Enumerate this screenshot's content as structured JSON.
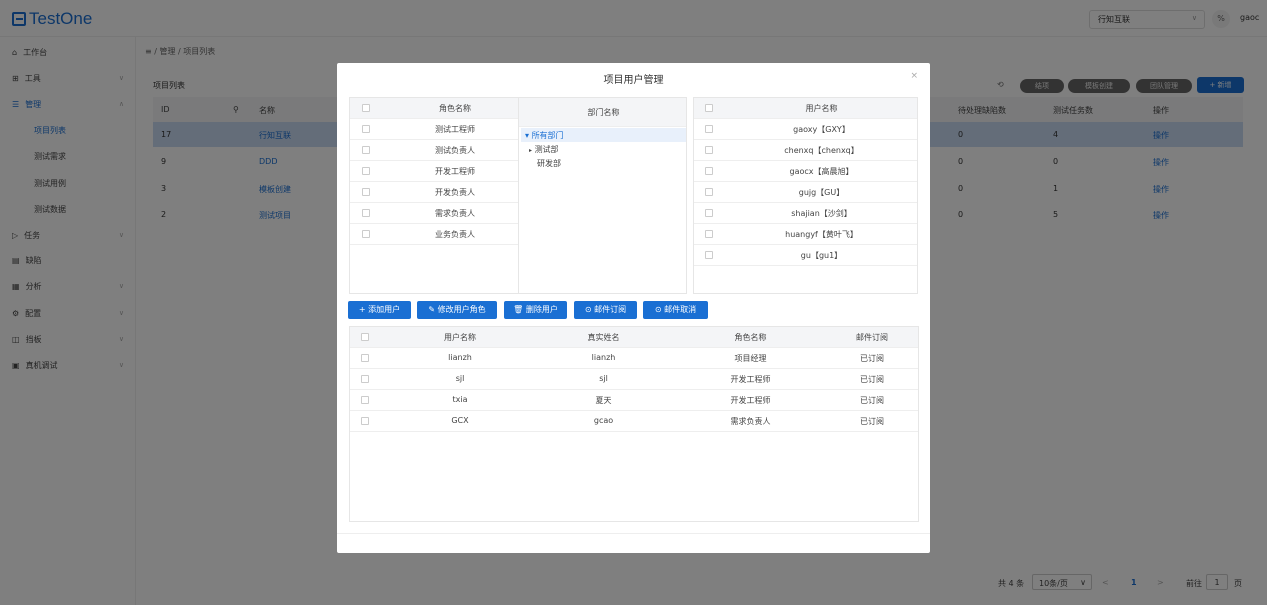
{
  "app": {
    "logo_text": "TestOne",
    "project_selected": "行知互联",
    "user_name": "gaoc",
    "user_icon": "%"
  },
  "sidebar": {
    "items": [
      {
        "label": "工作台"
      },
      {
        "label": "工具"
      },
      {
        "label": "管理"
      },
      {
        "label": "任务"
      },
      {
        "label": "缺陷"
      },
      {
        "label": "分析"
      },
      {
        "label": "配置"
      },
      {
        "label": "挡板"
      },
      {
        "label": "真机调试"
      }
    ],
    "subitems": [
      {
        "label": "项目列表"
      },
      {
        "label": "测试需求"
      },
      {
        "label": "测试用例"
      },
      {
        "label": "测试数据"
      }
    ]
  },
  "breadcrumb": {
    "home": "≡",
    "sep": "/",
    "parent": "管理",
    "current": "项目列表"
  },
  "page": {
    "section_title": "项目列表",
    "buttons": {
      "refresh": "⟲",
      "finish": "结项",
      "template": "模板创建",
      "team": "团队管理",
      "new": "+ 新增"
    },
    "columns": [
      "ID",
      "名称",
      "待处理缺陷数",
      "测试任务数",
      "操作"
    ],
    "rows": [
      {
        "id": "17",
        "name": "行知互联",
        "defects": "0",
        "tasks": "4",
        "action": "操作"
      },
      {
        "id": "9",
        "name": "DDD",
        "defects": "0",
        "tasks": "0",
        "action": "操作"
      },
      {
        "id": "3",
        "name": "模板创建",
        "defects": "0",
        "tasks": "1",
        "action": "操作"
      },
      {
        "id": "2",
        "name": "测试项目",
        "defects": "0",
        "tasks": "5",
        "action": "操作"
      }
    ],
    "pagination": {
      "total": "共 4 条",
      "page_size": "10条/页",
      "prev": "<",
      "page": "1",
      "next": ">",
      "goto_label": "前往",
      "goto_value": "1",
      "page_suffix": "页"
    }
  },
  "modal": {
    "title": "项目用户管理",
    "close": "×",
    "roles": {
      "header": "角色名称",
      "items": [
        "测试工程师",
        "测试负责人",
        "开发工程师",
        "开发负责人",
        "需求负责人",
        "业务负责人"
      ]
    },
    "departments": {
      "header": "部门名称",
      "root": "所有部门",
      "children": [
        "测试部",
        "研发部"
      ]
    },
    "users": {
      "header": "用户名称",
      "items": [
        "gaoxy【GXY】",
        "chenxq【chenxq】",
        "gaocx【高晨旭】",
        "gujg【GU】",
        "shajian【沙剑】",
        "huangyf【黄叶飞】",
        "gu【gu1】"
      ]
    },
    "actions": {
      "add": "+ 添加用户",
      "edit": "修改用户角色",
      "delete": "删除用户",
      "subscribe": "邮件订阅",
      "unsubscribe": "邮件取消"
    },
    "member_table": {
      "columns": [
        "用户名称",
        "真实姓名",
        "角色名称",
        "邮件订阅"
      ],
      "rows": [
        {
          "username": "lianzh",
          "realname": "lianzh",
          "role": "项目经理",
          "mail": "已订阅"
        },
        {
          "username": "sjl",
          "realname": "sjl",
          "role": "开发工程师",
          "mail": "已订阅"
        },
        {
          "username": "txia",
          "realname": "夏天",
          "role": "开发工程师",
          "mail": "已订阅"
        },
        {
          "username": "GCX",
          "realname": "gcao",
          "role": "需求负责人",
          "mail": "已订阅"
        }
      ]
    }
  },
  "colors": {
    "primary": "#1a6fd3",
    "overlay": "rgba(0,0,0,0.5)"
  }
}
